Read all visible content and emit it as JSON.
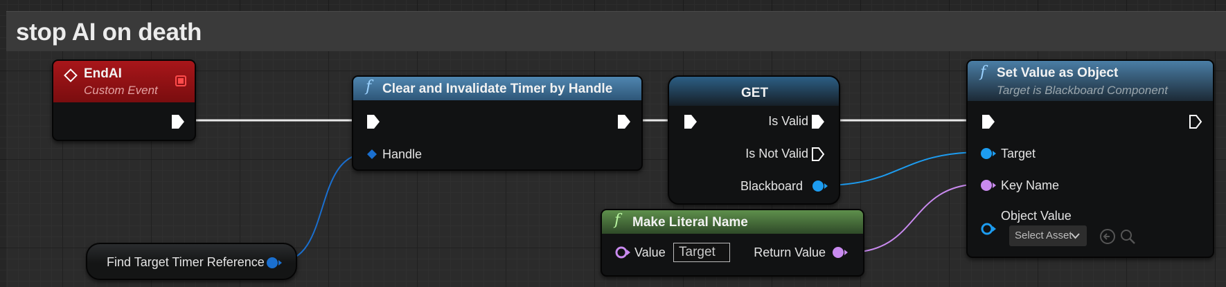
{
  "comment": {
    "title": "stop AI on death"
  },
  "nodes": {
    "end_ai": {
      "title": "EndAI",
      "subtitle": "Custom Event"
    },
    "clear_timer": {
      "title": "Clear and Invalidate Timer by Handle",
      "handle_label": "Handle"
    },
    "get": {
      "title": "GET",
      "is_valid": "Is Valid",
      "is_not_valid": "Is Not Valid",
      "blackboard": "Blackboard"
    },
    "set_value": {
      "title": "Set Value as Object",
      "subtitle": "Target is Blackboard Component",
      "target": "Target",
      "key_name": "Key Name",
      "object_value": "Object Value",
      "select_asset": "Select Asset"
    },
    "make_literal": {
      "title": "Make Literal Name",
      "value_label": "Value",
      "value_input": "Target",
      "return_value": "Return Value"
    },
    "find_timer": {
      "label": "Find Target Timer Reference"
    }
  },
  "icons": {
    "function": "f",
    "chevron": "chevron-down-icon",
    "use_selected": "arrow-left-circle-icon",
    "browse": "search-icon"
  },
  "colors": {
    "event_header": "#8e1010",
    "function_header": "#3f6f94",
    "pure_function_header": "#4e7a3f",
    "object_pin": "#1d9cf0",
    "name_pin": "#c98aef",
    "handle_pin": "#1a6fcf",
    "exec_pin": "#ffffff"
  }
}
